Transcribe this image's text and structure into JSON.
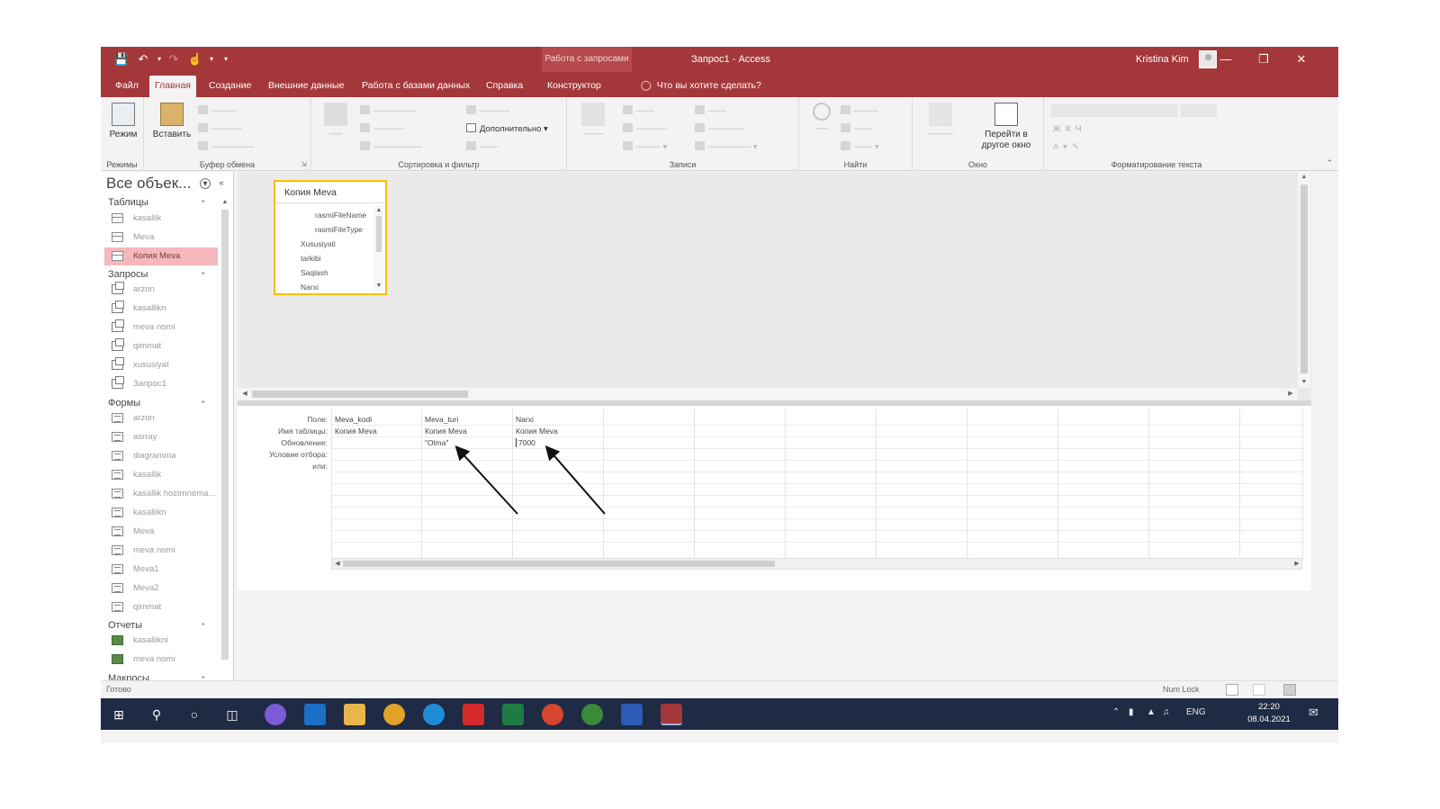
{
  "titlebar": {
    "context_title": "Работа с запросами",
    "doc_title": "Запрос1 - Access",
    "user_name": "Kristina Kim"
  },
  "menu": {
    "tabs": [
      "Файл",
      "Главная",
      "Создание",
      "Внешние данные",
      "Работа с базами данных",
      "Справка",
      "Конструктор"
    ],
    "active_tab": "Главная",
    "tell_me": "Что вы хотите сделать?"
  },
  "ribbon": {
    "groups": {
      "modes": "Режимы",
      "clipboard": "Буфер обмена",
      "sort_filter": "Сортировка и фильтр",
      "records": "Записи",
      "find": "Найти",
      "window": "Окно",
      "text_format": "Форматирование текста"
    },
    "mode_button": "Режим",
    "paste_button": "Вставить",
    "advanced_button": "Дополнительно",
    "switch_window_button": "Перейти в другое окно"
  },
  "nav": {
    "title": "Все объек...",
    "sections": {
      "tables": "Таблицы",
      "queries": "Запросы",
      "forms": "Формы",
      "reports": "Отчеты",
      "macros": "Макросы"
    },
    "tables": [
      "kasallik",
      "Meva",
      "Копия Meva"
    ],
    "selected_table": "Копия Meva",
    "queries": [
      "arzon",
      "kasallikn",
      "meva nomi",
      "qimmat",
      "xususiyat",
      "Запрос1"
    ],
    "forms": [
      "arzon",
      "asrray",
      "diagramma",
      "kasallik",
      "kasallik hozirnnema...",
      "kasallikn",
      "Meva",
      "meva nomi",
      "Meva1",
      "Meva2",
      "qimmat"
    ],
    "reports": [
      "kasallikni",
      "meva nomi"
    ]
  },
  "query_table": {
    "name": "Копия Meva",
    "fields": [
      "rasmiFileName",
      "rasmiFileType",
      "Xususiyati",
      "tarkibi",
      "Saqlash",
      "Narxi"
    ]
  },
  "grid": {
    "row_labels": [
      "Поле:",
      "Имя таблицы:",
      "Обновление:",
      "Условие отбора:",
      "или:"
    ],
    "columns": [
      {
        "field": "Meva_kodi",
        "table": "Копия Meva",
        "update": ""
      },
      {
        "field": "Meva_turi",
        "table": "Копия Meva",
        "update": "\"Olma\""
      },
      {
        "field": "Narxi",
        "table": "Копия Meva",
        "update": "7000"
      }
    ]
  },
  "status": {
    "ready": "Готово",
    "numlock": "Num Lock"
  },
  "taskbar": {
    "lang": "ENG",
    "time": "22:20",
    "date": "08.04.2021"
  },
  "colors": {
    "accent": "#a4373a",
    "selection": "#f4b8bd",
    "table_border": "#f2c200",
    "taskbar": "#1f2a44"
  }
}
